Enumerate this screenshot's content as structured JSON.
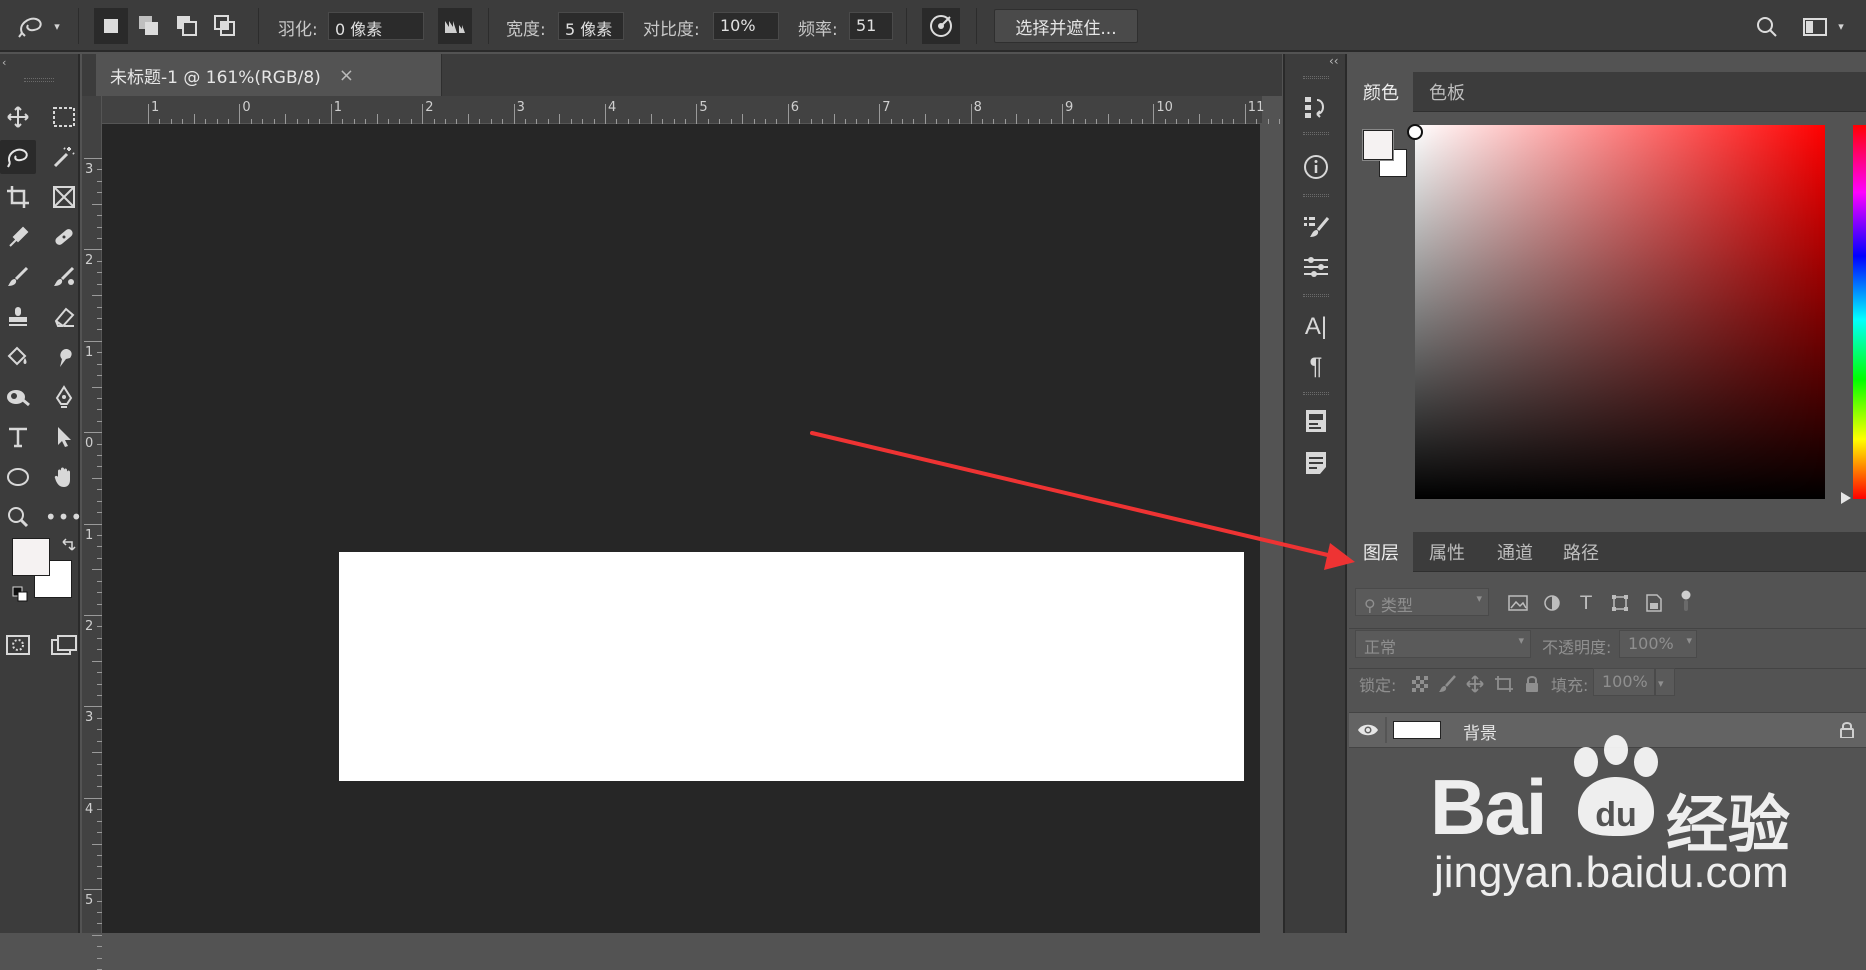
{
  "options_bar": {
    "feather_label": "羽化:",
    "feather_value": "0 像素",
    "width_label": "宽度:",
    "width_value": "5 像素",
    "contrast_label": "对比度:",
    "contrast_value": "10%",
    "frequency_label": "频率:",
    "frequency_value": "51",
    "select_mask_button": "选择并遮住..."
  },
  "document": {
    "tab_title": "未标题-1 @ 161%(RGB/8)",
    "close_glyph": "×",
    "background_color": "#ffffff"
  },
  "rulers": {
    "horizontal": [
      "1",
      "0",
      "1",
      "2",
      "3",
      "4",
      "5",
      "6",
      "7",
      "8",
      "9",
      "10",
      "11"
    ],
    "vertical": [
      "3",
      "2",
      "1",
      "0",
      "1",
      "2",
      "3",
      "4",
      "5"
    ]
  },
  "color_panel": {
    "tabs": [
      "颜色",
      "色板"
    ],
    "active_tab": "颜色",
    "foreground": "#f5f2f2",
    "background": "#ffffff",
    "hue_color": "#ff0000"
  },
  "layers_panel": {
    "tabs": [
      "图层",
      "属性",
      "通道",
      "路径"
    ],
    "active_tab": "图层",
    "filter_placeholder": "类型",
    "blend_mode": "正常",
    "opacity_label": "不透明度:",
    "opacity_value": "100%",
    "lock_label": "锁定:",
    "fill_label": "填充:",
    "fill_value": "100%",
    "layers": [
      {
        "name": "背景",
        "visible": true,
        "locked": true
      }
    ]
  },
  "watermark": {
    "brand": "Bai",
    "brand_suffix": "经验",
    "url": "jingyan.baidu.com"
  },
  "colors": {
    "annotation_arrow": "#ee3333",
    "canvas_bg": "#262626",
    "ui_bg": "#3c3c3c",
    "panel_bg": "#535353"
  },
  "icons": {
    "toolbar": [
      "move-icon",
      "marquee-icon",
      "magnetic-lasso-icon",
      "magic-wand-icon",
      "crop-icon",
      "frame-icon",
      "eyedropper-icon",
      "healing-brush-icon",
      "brush-icon",
      "mixer-brush-icon",
      "clone-stamp-icon",
      "eraser-icon",
      "paint-bucket-icon",
      "smudge-icon",
      "dodge-icon",
      "pen-icon",
      "type-icon",
      "path-select-icon",
      "ellipse-icon",
      "hand-icon",
      "zoom-icon",
      "more-tools-icon"
    ],
    "dock": [
      "history-icon",
      "info-icon",
      "brush-settings-icon",
      "adjustments-icon",
      "character-icon",
      "paragraph-icon",
      "libraries-icon",
      "notes-icon"
    ]
  }
}
